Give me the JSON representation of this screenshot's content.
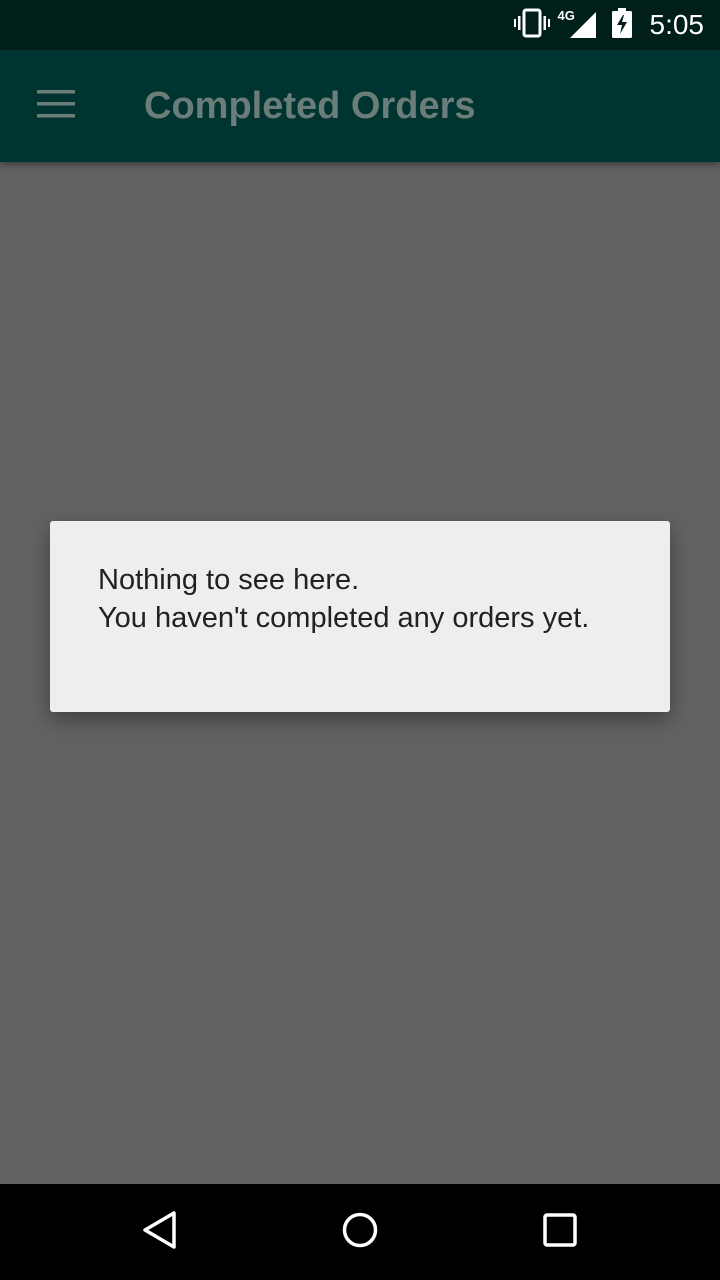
{
  "status_bar": {
    "network": "4G",
    "time": "5:05",
    "icons": [
      "vibrate-icon",
      "signal-icon",
      "battery-charging-icon"
    ]
  },
  "app_bar": {
    "title": "Completed Orders",
    "menu_icon": "hamburger-menu-icon"
  },
  "dialog": {
    "line1": "Nothing to see here.",
    "line2": "You haven't completed any orders yet."
  },
  "nav_bar": {
    "icons": [
      "back-icon",
      "home-icon",
      "recents-icon"
    ]
  },
  "colors": {
    "status_bar": "#001f1a",
    "app_bar": "#003430",
    "title_text": "#6b7d79",
    "scrim_background": "#626262",
    "dialog_background": "#eeeeee",
    "dialog_text": "#212121"
  }
}
